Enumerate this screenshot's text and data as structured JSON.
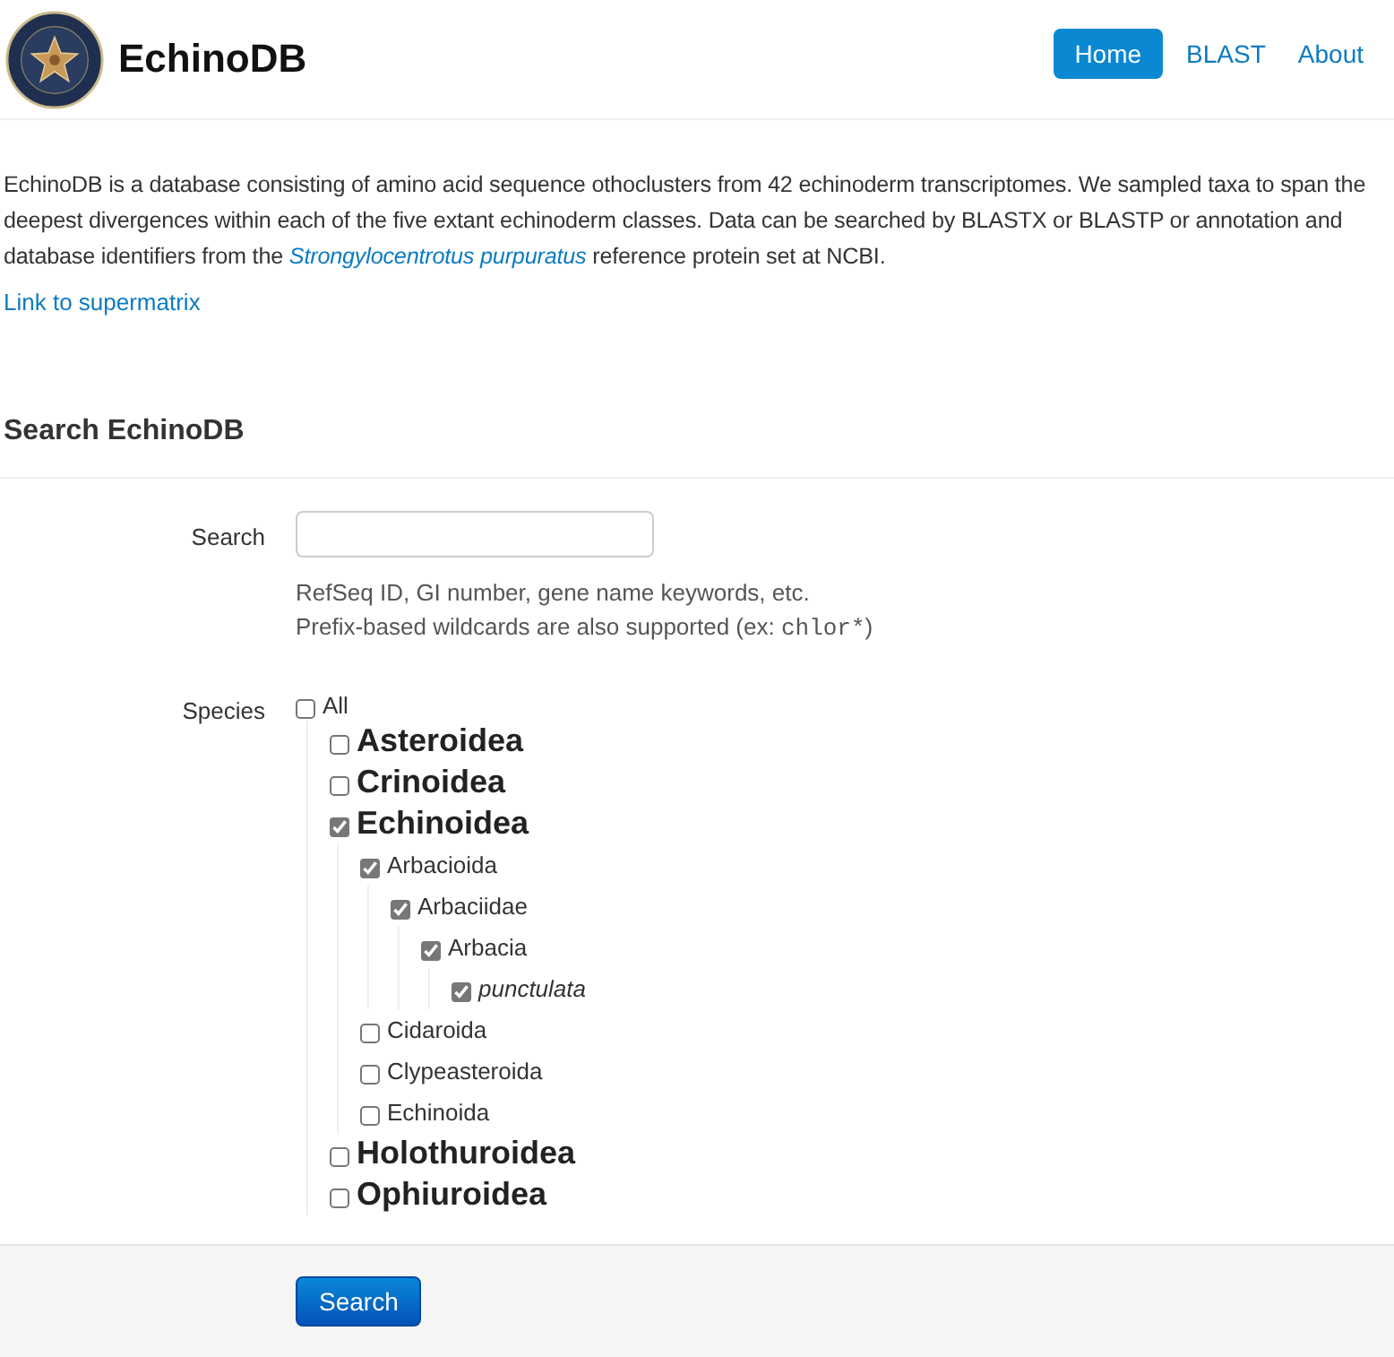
{
  "site": {
    "title": "EchinoDB"
  },
  "nav": [
    {
      "label": "Home",
      "selected": true
    },
    {
      "label": "BLAST",
      "selected": false
    },
    {
      "label": "About",
      "selected": false
    }
  ],
  "intro": {
    "before": "EchinoDB is a database consisting of amino acid sequence othoclusters from 42 echinoderm transcriptomes. We sampled taxa to span the deepest divergences within each of the five extant echinoderm classes. Data can be searched by BLASTX or BLASTP or annotation and database identifiers from the ",
    "link": "Strongylocentrotus purpuratus",
    "after": " reference protein set at NCBI."
  },
  "supermatrix_link": "Link to supermatrix",
  "section_title": "Search EchinoDB",
  "search": {
    "label": "Search",
    "help_line_1": "RefSeq ID, GI number, gene name keywords, etc.",
    "help_line_2_before": "Prefix-based wildcards are also supported (ex: ",
    "help_line_2_code": "chlor*",
    "help_line_2_after": ")"
  },
  "species": {
    "label": "Species",
    "all": {
      "label": "All",
      "checked": false
    },
    "tree": [
      {
        "kind": "class",
        "label": "Asteroidea",
        "checked": false
      },
      {
        "kind": "class",
        "label": "Crinoidea",
        "checked": false
      },
      {
        "kind": "class",
        "label": "Echinoidea",
        "checked": true,
        "children": [
          {
            "kind": "order",
            "label": "Arbacioida",
            "checked": true,
            "children": [
              {
                "kind": "order",
                "label": "Arbaciidae",
                "checked": true,
                "children": [
                  {
                    "kind": "order",
                    "label": "Arbacia",
                    "checked": true,
                    "children": [
                      {
                        "kind": "species",
                        "label": "punctulata",
                        "checked": true
                      }
                    ]
                  }
                ]
              }
            ]
          },
          {
            "kind": "order",
            "label": "Cidaroida",
            "checked": false
          },
          {
            "kind": "order",
            "label": "Clypeasteroida",
            "checked": false
          },
          {
            "kind": "order",
            "label": "Echinoida",
            "checked": false
          }
        ]
      },
      {
        "kind": "class",
        "label": "Holothuroidea",
        "checked": false
      },
      {
        "kind": "class",
        "label": "Ophiuroidea",
        "checked": false
      }
    ]
  },
  "submit": "Search"
}
